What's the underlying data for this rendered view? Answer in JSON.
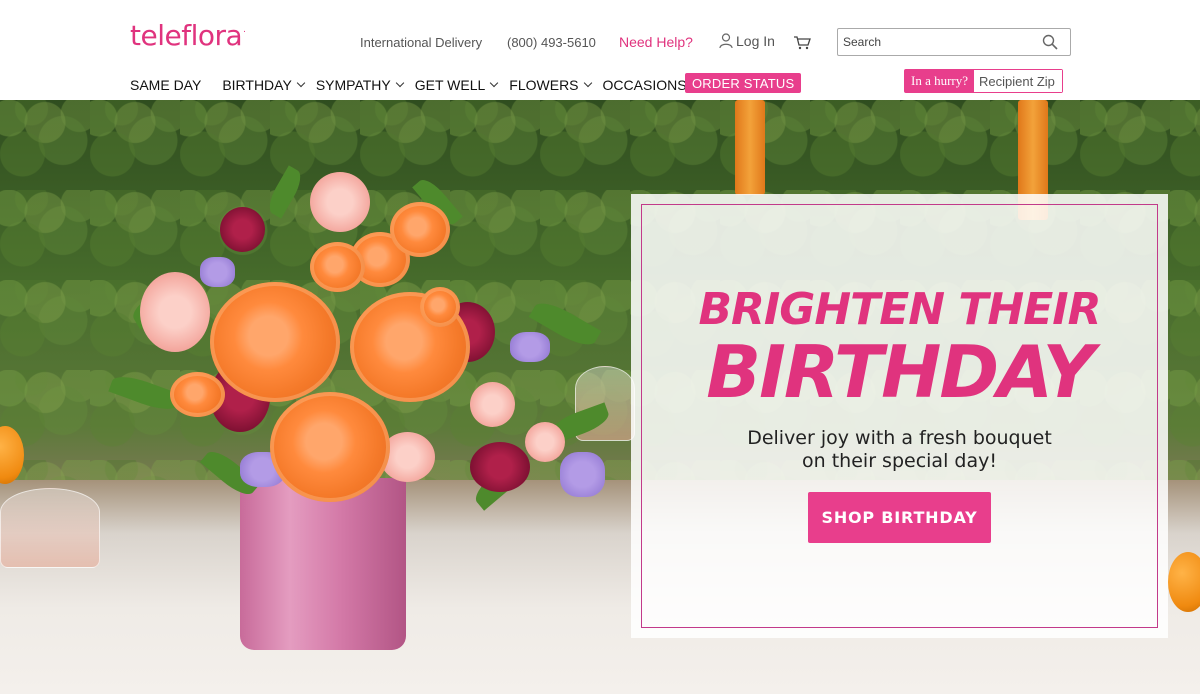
{
  "brand": {
    "logo_text": "teleflora",
    "logo_mark": "."
  },
  "utility": {
    "international": "International Delivery",
    "phone": "(800) 493-5610",
    "help": "Need Help?",
    "login": "Log In",
    "search_placeholder": "Search"
  },
  "nav": {
    "items": [
      {
        "label": "SAME DAY",
        "dropdown": false
      },
      {
        "label": "BIRTHDAY",
        "dropdown": true
      },
      {
        "label": "SYMPATHY",
        "dropdown": true
      },
      {
        "label": "GET WELL",
        "dropdown": true
      },
      {
        "label": "FLOWERS",
        "dropdown": true
      },
      {
        "label": "OCCASIONS",
        "dropdown": true
      }
    ],
    "order_status": "ORDER STATUS"
  },
  "zip": {
    "hurry_label": "In a hurry?",
    "placeholder": "Recipient Zip"
  },
  "hero": {
    "headline_1": "BRIGHTEN THEIR",
    "headline_2": "BIRTHDAY",
    "subtext_1": "Deliver joy with a fresh bouquet",
    "subtext_2": "on their special day!",
    "cta": "SHOP BIRTHDAY"
  },
  "colors": {
    "brand_pink": "#e83e8c",
    "logo_pink": "#e0337e",
    "panel_border": "#c23a8a"
  },
  "icons": {
    "user": "user-icon",
    "cart": "cart-icon",
    "search": "search-icon",
    "chevron": "chevron-down-icon"
  }
}
